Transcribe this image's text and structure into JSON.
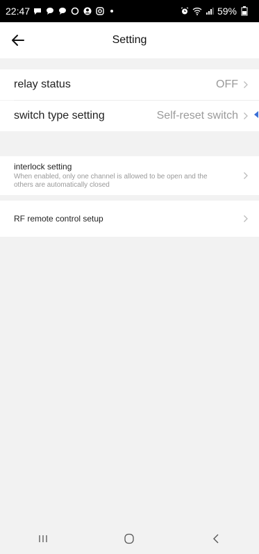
{
  "status_bar": {
    "time": "22:47",
    "battery": "59%"
  },
  "header": {
    "title": "Setting"
  },
  "rows": {
    "relay_status": {
      "label": "relay status",
      "value": "OFF"
    },
    "switch_type": {
      "label": "switch type setting",
      "value": "Self-reset switch"
    },
    "interlock": {
      "label": "interlock setting",
      "description": "When enabled, only one channel is allowed to be open and the others are automatically closed"
    },
    "rf_remote": {
      "label": "RF remote control setup"
    }
  },
  "colors": {
    "accent_blue": "#3b6fd6",
    "value_gray": "#9a9a9a",
    "background": "#f2f2f2"
  }
}
